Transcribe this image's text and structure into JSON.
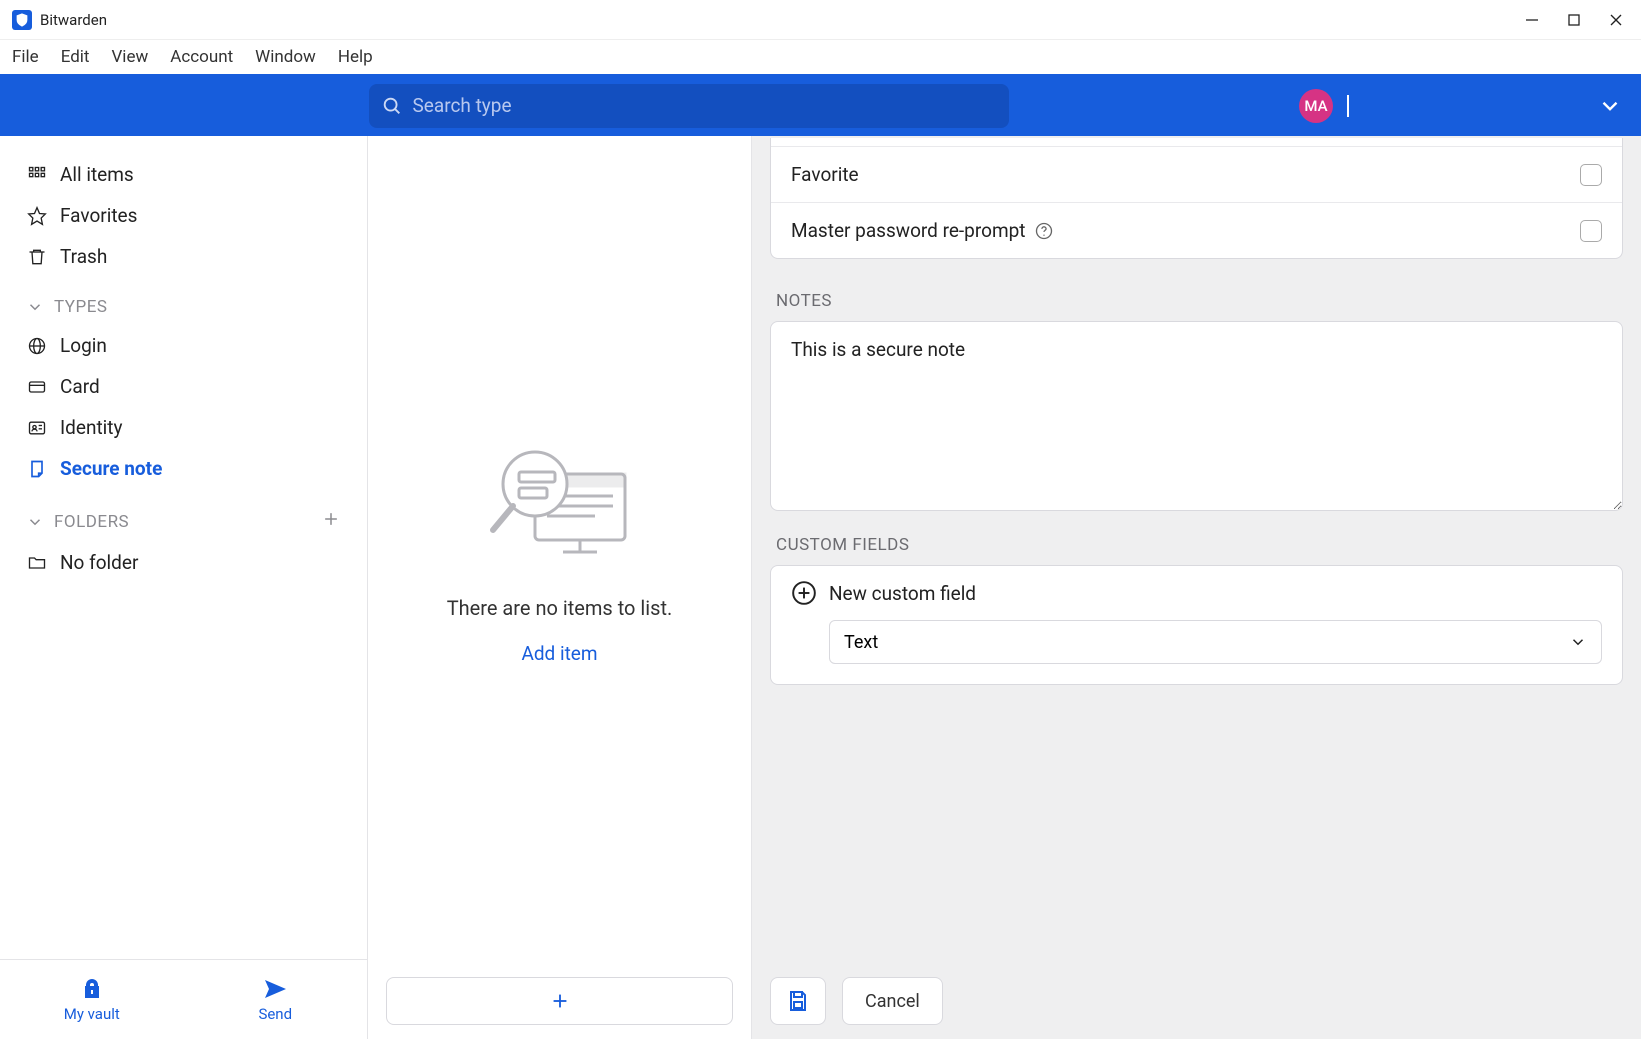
{
  "window": {
    "title": "Bitwarden"
  },
  "menubar": {
    "items": [
      "File",
      "Edit",
      "View",
      "Account",
      "Window",
      "Help"
    ]
  },
  "topbar": {
    "search_placeholder": "Search type",
    "avatar_initials": "MA"
  },
  "sidebar": {
    "nav": [
      {
        "label": "All items",
        "icon": "grid"
      },
      {
        "label": "Favorites",
        "icon": "star"
      },
      {
        "label": "Trash",
        "icon": "trash"
      }
    ],
    "types_header": "TYPES",
    "types": [
      {
        "label": "Login",
        "icon": "globe"
      },
      {
        "label": "Card",
        "icon": "card"
      },
      {
        "label": "Identity",
        "icon": "identity"
      },
      {
        "label": "Secure note",
        "icon": "note",
        "active": true
      }
    ],
    "folders_header": "FOLDERS",
    "folders": [
      {
        "label": "No folder",
        "icon": "folder"
      }
    ],
    "footer": {
      "my_vault": "My vault",
      "send": "Send"
    }
  },
  "middle": {
    "empty_text": "There are no items to list.",
    "add_item": "Add item"
  },
  "detail": {
    "options": {
      "favorite_label": "Favorite",
      "reprompt_label": "Master password re-prompt"
    },
    "notes_header": "NOTES",
    "notes_value": "This is a secure note",
    "custom_fields_header": "CUSTOM FIELDS",
    "new_custom_field_label": "New custom field",
    "field_type_selected": "Text",
    "cancel_label": "Cancel"
  }
}
